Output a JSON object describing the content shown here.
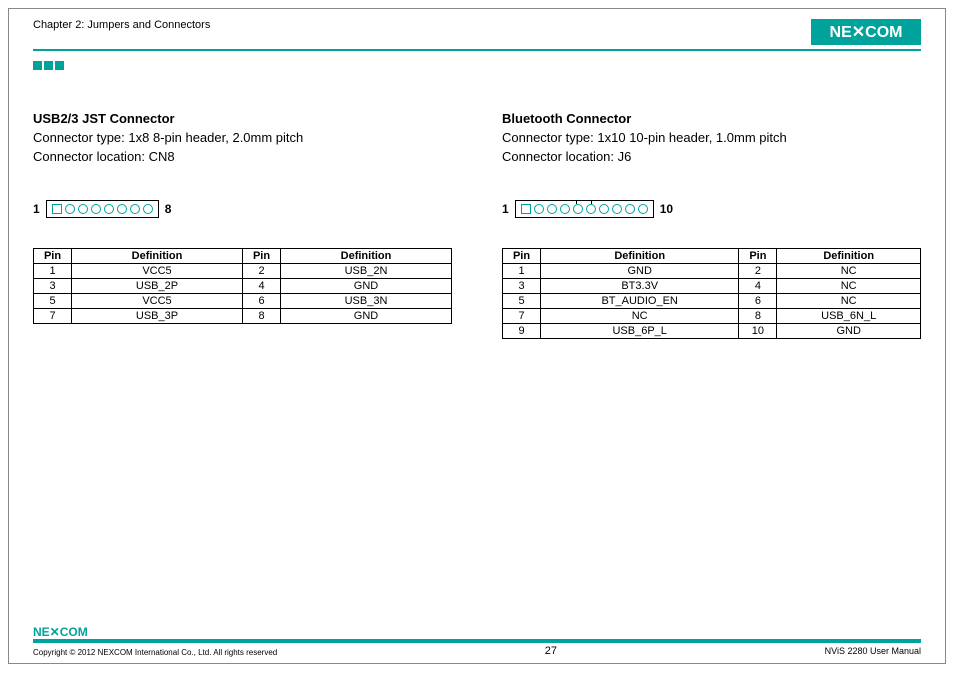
{
  "chapter": "Chapter 2: Jumpers and Connectors",
  "logo_text": "NEXCOM",
  "left": {
    "title": "USB2/3 JST Connector",
    "type_line": "Connector type: 1x8 8-pin header, 2.0mm pitch",
    "loc_line": "Connector location: CN8",
    "pin_start": "1",
    "pin_end": "8",
    "headers": {
      "pin": "Pin",
      "def": "Definition"
    },
    "rows": [
      {
        "p1": "1",
        "d1": "VCC5",
        "p2": "2",
        "d2": "USB_2N"
      },
      {
        "p1": "3",
        "d1": "USB_2P",
        "p2": "4",
        "d2": "GND"
      },
      {
        "p1": "5",
        "d1": "VCC5",
        "p2": "6",
        "d2": "USB_3N"
      },
      {
        "p1": "7",
        "d1": "USB_3P",
        "p2": "8",
        "d2": "GND"
      }
    ]
  },
  "right": {
    "title": "Bluetooth Connector",
    "type_line": "Connector type: 1x10 10-pin header, 1.0mm pitch",
    "loc_line": "Connector location: J6",
    "pin_start": "1",
    "pin_end": "10",
    "headers": {
      "pin": "Pin",
      "def": "Definition"
    },
    "rows": [
      {
        "p1": "1",
        "d1": "GND",
        "p2": "2",
        "d2": "NC"
      },
      {
        "p1": "3",
        "d1": "BT3.3V",
        "p2": "4",
        "d2": "NC"
      },
      {
        "p1": "5",
        "d1": "BT_AUDIO_EN",
        "p2": "6",
        "d2": "NC"
      },
      {
        "p1": "7",
        "d1": "NC",
        "p2": "8",
        "d2": "USB_6N_L"
      },
      {
        "p1": "9",
        "d1": "USB_6P_L",
        "p2": "10",
        "d2": "GND"
      }
    ]
  },
  "footer": {
    "copyright": "Copyright © 2012 NEXCOM International Co., Ltd. All rights reserved",
    "page": "27",
    "manual": "NViS 2280 User Manual"
  }
}
